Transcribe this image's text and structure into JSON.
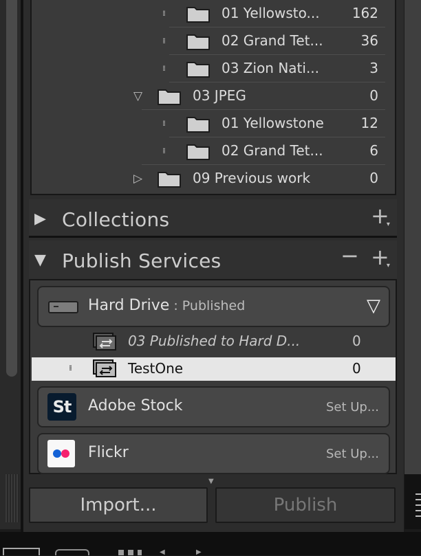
{
  "folders": [
    {
      "label": "01 Yellowsto...",
      "count": "162",
      "level": 2,
      "expander": "dots"
    },
    {
      "label": "02 Grand Tet...",
      "count": "36",
      "level": 2,
      "expander": "dots"
    },
    {
      "label": "03 Zion Nati...",
      "count": "3",
      "level": 2,
      "expander": "dots"
    },
    {
      "label": "03 JPEG",
      "count": "0",
      "level": 1,
      "expander": "expanded"
    },
    {
      "label": "01 Yellowstone",
      "count": "12",
      "level": 2,
      "expander": "dots"
    },
    {
      "label": "02 Grand Tet...",
      "count": "6",
      "level": 2,
      "expander": "dots"
    },
    {
      "label": "09 Previous work",
      "count": "0",
      "level": 1,
      "expander": "collapsed"
    }
  ],
  "collections": {
    "title": "Collections",
    "add_icon": "plus-icon"
  },
  "publish_services": {
    "title": "Publish Services",
    "hard_drive": {
      "name": "Hard Drive",
      "separator": " : ",
      "status": "Published",
      "icon": "hard-drive-icon"
    },
    "published_collections": [
      {
        "label": "03 Published to Hard D...",
        "count": "0",
        "selected": false,
        "italic": true
      },
      {
        "label": "TestOne",
        "count": "0",
        "selected": true,
        "italic": false
      }
    ],
    "adobe_stock": {
      "name": "Adobe Stock",
      "logo_text": "St",
      "setup": "Set Up..."
    },
    "flickr": {
      "name": "Flickr",
      "setup": "Set Up..."
    }
  },
  "buttons": {
    "import": "Import...",
    "publish": "Publish"
  },
  "colors": {
    "selected_row": "#e6e6e6",
    "panel": "#3a3a3a",
    "stock_bg": "#081b2e",
    "flickr_blue": "#1462d6",
    "flickr_pink": "#f5206e"
  }
}
